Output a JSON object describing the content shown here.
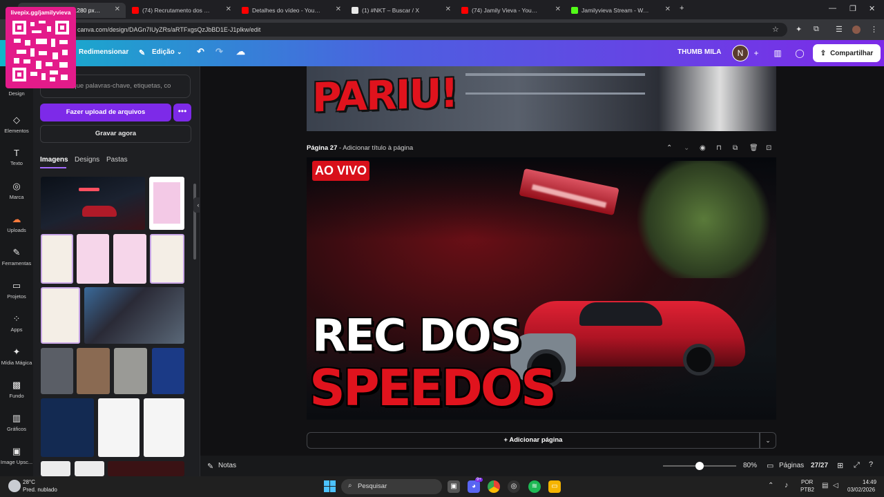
{
  "browser": {
    "tabs": [
      {
        "title": "THUMB MILA - 1280 px × 720 px",
        "favicon_color": "#7d2ae8"
      },
      {
        "title": "(74) Recrutamento dos Spe",
        "favicon_color": "#ff0000"
      },
      {
        "title": "Detalhes do vídeo - YouTube Studio",
        "favicon_color": "#ff0000"
      },
      {
        "title": "(1) #NKT – Buscar / X",
        "favicon_color": "#ffffff"
      },
      {
        "title": "(74) Jamily Vieva - YouTube",
        "favicon_color": "#ff0000"
      },
      {
        "title": "Jamilyvieva Stream - Watch Live",
        "favicon_color": "#53fc18"
      }
    ],
    "new_tab": "+",
    "url": "canva.com/design/DAGn7IUyZRs/aRTFxgsQzJbBD1E-J1plkw/edit"
  },
  "overlay": {
    "qr_label": "livepix.gg/jamilyvieva"
  },
  "canva_bar": {
    "resize": "Redimensionar",
    "edit": "Edição",
    "design_title": "THUMB MILA",
    "avatar_initial": "N",
    "share": "Compartilhar"
  },
  "rail": [
    {
      "label": "Design",
      "icon": "design-icon",
      "glyph": "▦"
    },
    {
      "label": "Elementos",
      "icon": "elements-icon",
      "glyph": "◇"
    },
    {
      "label": "Texto",
      "icon": "text-icon",
      "glyph": "T"
    },
    {
      "label": "Marca",
      "icon": "brand-icon",
      "glyph": "◎"
    },
    {
      "label": "Uploads",
      "icon": "uploads-icon",
      "glyph": "☁"
    },
    {
      "label": "Ferramentas",
      "icon": "tools-icon",
      "glyph": "✎"
    },
    {
      "label": "Projetos",
      "icon": "folder-icon",
      "glyph": "▭"
    },
    {
      "label": "Apps",
      "icon": "apps-icon",
      "glyph": "⁘"
    },
    {
      "label": "Mídia Mágica",
      "icon": "magic-media-icon",
      "glyph": "✦"
    },
    {
      "label": "Fundo",
      "icon": "background-icon",
      "glyph": "▩"
    },
    {
      "label": "Gráficos",
      "icon": "charts-icon",
      "glyph": "▥"
    },
    {
      "label": "Image Upsc...",
      "icon": "image-upscaler-icon",
      "glyph": "▣"
    }
  ],
  "panel": {
    "search_placeholder": "Busque palavras-chave, etiquetas, co",
    "upload": "Fazer upload de arquivos",
    "more": "•••",
    "record": "Gravar agora",
    "tabs": [
      "Imagens",
      "Designs",
      "Pastas"
    ]
  },
  "editor": {
    "prev_page_text": "PARIU!",
    "page_label": "Página 27",
    "page_title_placeholder": "Adicionar título à página",
    "badge": "AO VIVO",
    "headline_1": "REC DOS",
    "headline_2": "SPEEDOS",
    "add_page": "+ Adicionar página"
  },
  "footer": {
    "notes": "Notas",
    "zoom": "80%",
    "zoom_level": 0.5,
    "pages_label": "Páginas",
    "page_count": "27/27"
  },
  "taskbar": {
    "weather_temp": "28°C",
    "weather_desc": "Pred. nublado",
    "search": "Pesquisar",
    "lang": "POR",
    "layout": "PTB2",
    "time": "14:49",
    "date": "03/02/2026",
    "discord_badge": "9+"
  },
  "colors": {
    "accent": "#7d2ae8",
    "headline_red": "#e0131d",
    "badge_red": "#d8101a"
  }
}
